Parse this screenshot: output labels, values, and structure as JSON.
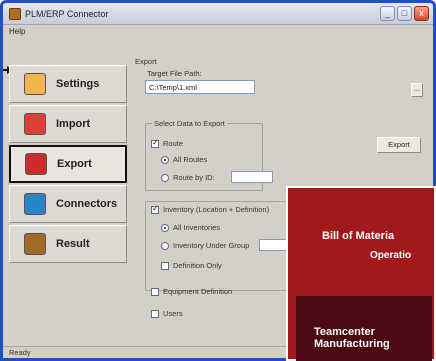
{
  "window": {
    "title": "PLM/ERP Connector",
    "buttons": [
      "_",
      "□",
      "x"
    ],
    "menu": [
      "Help"
    ],
    "status": "Ready"
  },
  "colors": {
    "title_border": "#1f4fc4",
    "window_bg": "#d4d0c8",
    "overlay_red": "#a1191b",
    "overlay_dark": "#4c0a12"
  },
  "nav": {
    "items": [
      {
        "label": "Settings",
        "icon": "wrench-screwdriver-icon",
        "color": "#f1b64f"
      },
      {
        "label": "Import",
        "icon": "box-in-arrow-icon",
        "color": "#d84236"
      },
      {
        "label": "Export",
        "icon": "box-out-arrow-icon",
        "color": "#cc2b2b"
      },
      {
        "label": "Connectors",
        "icon": "puzzle-connectors-icon",
        "color": "#2a85c7"
      },
      {
        "label": "Result",
        "icon": "book-icon",
        "color": "#a36a2a"
      }
    ]
  },
  "export": {
    "group_title": "Export",
    "target_label": "Target File Path:",
    "target_value": "C:\\Temp\\1.xml",
    "browse_label": "...",
    "export_button": "Export",
    "select_title": "Select Data to Export",
    "route_label": "Route",
    "all_routes": "All Routes",
    "route_by_id": "Route by ID:",
    "inventory_label": "Inventory (Location + Definition)",
    "all_inventories": "All Inventories",
    "inventory_group": "Inventory Under Group",
    "definition_only": "Definition Only",
    "equipment_definition": "Equipment Definition",
    "users": "Users"
  },
  "overlay": {
    "title": "Bill of Materia",
    "subtitle": "Operatio",
    "label_line1": "Teamcenter",
    "label_line2": "Manufacturing"
  }
}
